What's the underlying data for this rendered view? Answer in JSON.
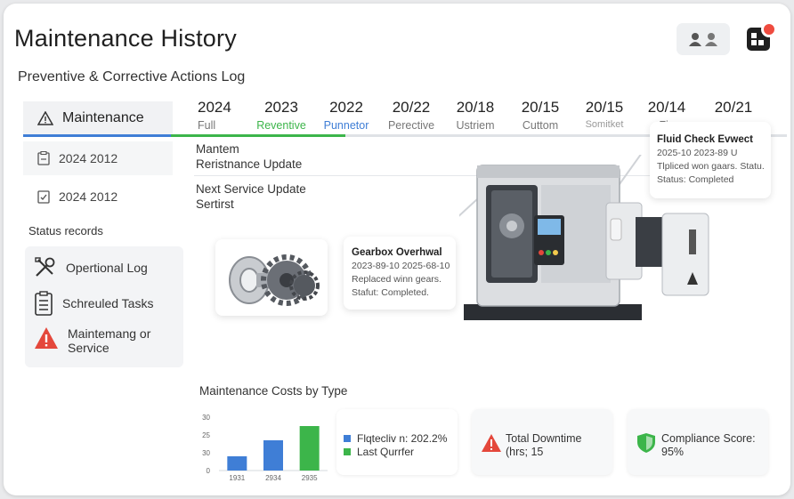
{
  "header": {
    "title": "Maintenance History",
    "subtitle": "Preventive & Corrective Actions Log"
  },
  "sidebar": {
    "tabs": [
      {
        "label": "Maintenance",
        "icon": "warning-icon"
      },
      {
        "label": "2024 2012",
        "icon": "clipboard-icon"
      },
      {
        "label": "2024 2012",
        "icon": "checklist-icon"
      }
    ],
    "status_label": "Status records",
    "status_items": [
      {
        "label": "Opertional Log",
        "icon": "tools-icon"
      },
      {
        "label": "Schreuled Tasks",
        "icon": "clipboard-list-icon"
      },
      {
        "label_line1": "Maintemang or",
        "label_line2": "Service",
        "icon": "alert-icon"
      }
    ]
  },
  "timeline": {
    "years": [
      {
        "year": "2024",
        "sub": "Full"
      },
      {
        "year": "2023",
        "sub": "Reventive"
      },
      {
        "year": "2022",
        "sub": "Punnetor"
      },
      {
        "year": "20/22",
        "sub": "Perective"
      },
      {
        "year": "20/18",
        "sub": "Ustriem"
      },
      {
        "year": "20/15",
        "sub": "Cuttom"
      },
      {
        "year": "20/15",
        "sub": "Somitket"
      },
      {
        "year": "20/14",
        "sub": "Fiu"
      },
      {
        "year": "20/21",
        "sub": ""
      }
    ],
    "entries": [
      {
        "line1": "Mantem",
        "line2": "Reristnance Update"
      },
      {
        "line1": "Next Service Update",
        "line2": "Sertirst"
      }
    ]
  },
  "cards": {
    "gearbox": {
      "title": "Gearbox Overhwal",
      "dates": "2023-89-10 2025-68-10",
      "desc": "Replaced winn gears.",
      "status": "Stafut: Completed."
    },
    "fluid": {
      "title": "Fluid Check Evwect",
      "dates": "2025-10 2023-89 U",
      "desc": "Tlpliced won gaars. Statu.",
      "status": "Status: Completed"
    }
  },
  "costs": {
    "title": "Maintenance Costs by Type",
    "legend": [
      {
        "label": "Flqtecliv n: 202.2%",
        "color": "#3f7ed6"
      },
      {
        "label": "Last Qurrfer",
        "color": "#3cb54a"
      }
    ],
    "downtime": {
      "line1": "Total Downtime",
      "line2": "(hrs; 15"
    },
    "compliance": {
      "line1": "Compliance Score:",
      "line2": "95%"
    }
  },
  "chart_data": {
    "type": "bar",
    "categories": [
      "1931",
      "2934",
      "2935"
    ],
    "values": [
      8,
      17,
      25
    ],
    "colors": [
      "#3f7ed6",
      "#3f7ed6",
      "#3cb54a"
    ],
    "yticks": [
      "30",
      "25",
      "30",
      "0"
    ],
    "ylim": [
      0,
      30
    ]
  },
  "colors": {
    "accent_blue": "#3f7ed6",
    "accent_green": "#3cb54a",
    "alert_red": "#e4473b"
  }
}
